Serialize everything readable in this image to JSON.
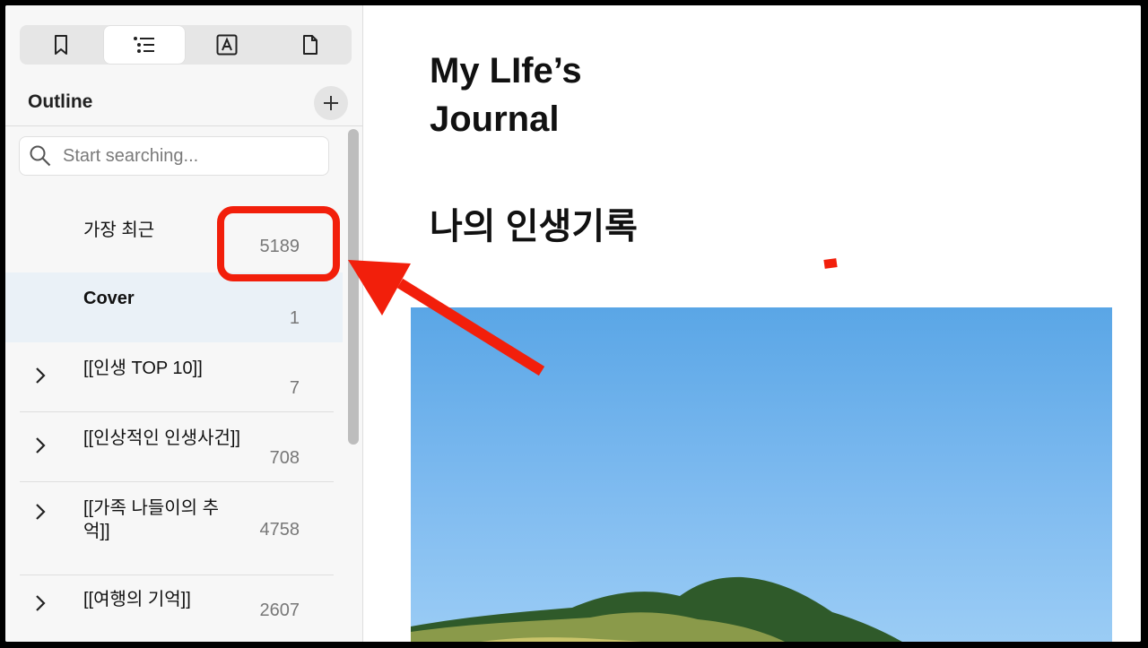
{
  "sidebar": {
    "tabs": [
      {
        "name": "bookmark-icon",
        "active": false
      },
      {
        "name": "outline-list-icon",
        "active": true
      },
      {
        "name": "text-box-icon",
        "active": false
      },
      {
        "name": "page-icon",
        "active": false
      }
    ],
    "outline_title": "Outline",
    "search": {
      "placeholder": "Start searching..."
    },
    "items": [
      {
        "title": "가장 최근",
        "count": "5189",
        "expandable": false,
        "bold": false
      },
      {
        "title": "Cover",
        "count": "1",
        "expandable": false,
        "bold": true
      },
      {
        "title": "[[인생 TOP 10]]",
        "count": "7",
        "expandable": true,
        "bold": false
      },
      {
        "title": "[[인상적인 인생사건]]",
        "count": "708",
        "expandable": true,
        "bold": false
      },
      {
        "title": "[[가족 나들이의 추억]]",
        "count": "4758",
        "expandable": true,
        "bold": false
      },
      {
        "title": "[[여행의 기억]]",
        "count": "2607",
        "expandable": true,
        "bold": false
      }
    ]
  },
  "document": {
    "title": "My LIfe’s Journal",
    "subtitle": "나의 인생기록"
  },
  "colors": {
    "annotation": "#f21f0b",
    "selected_row": "#eaf1f7",
    "sky": "#5aa6e6"
  }
}
